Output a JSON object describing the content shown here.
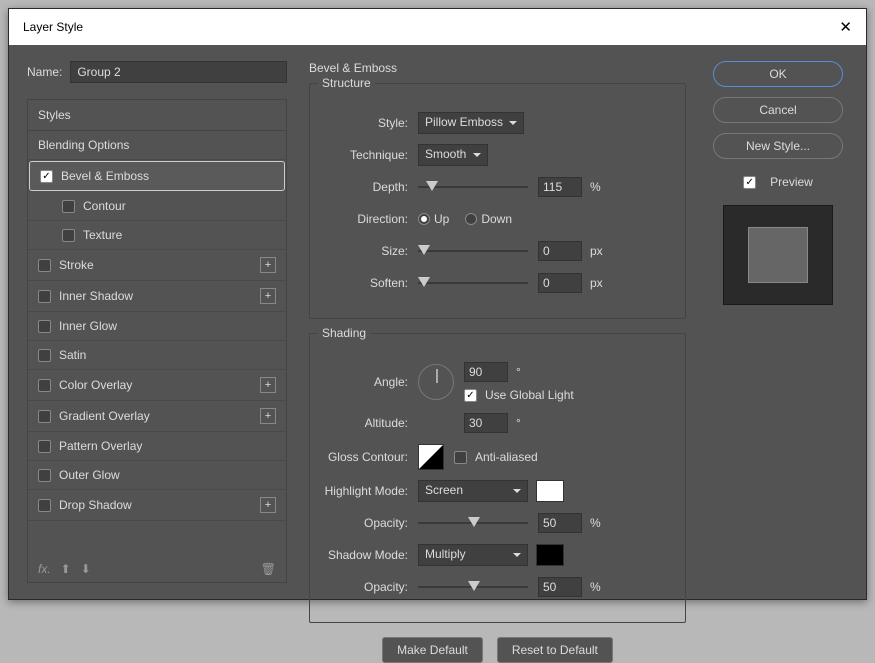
{
  "dialog": {
    "title": "Layer Style"
  },
  "name": {
    "label": "Name:",
    "value": "Group 2"
  },
  "styles_header": "Styles",
  "blending_options": "Blending Options",
  "styles": {
    "bevel": "Bevel & Emboss",
    "contour": "Contour",
    "texture": "Texture",
    "stroke": "Stroke",
    "inner_shadow": "Inner Shadow",
    "inner_glow": "Inner Glow",
    "satin": "Satin",
    "color_overlay": "Color Overlay",
    "gradient_overlay": "Gradient Overlay",
    "pattern_overlay": "Pattern Overlay",
    "outer_glow": "Outer Glow",
    "drop_shadow": "Drop Shadow"
  },
  "bevel": {
    "title": "Bevel & Emboss",
    "structure": {
      "legend": "Structure",
      "style_label": "Style:",
      "style_value": "Pillow Emboss",
      "technique_label": "Technique:",
      "technique_value": "Smooth",
      "depth_label": "Depth:",
      "depth_value": "115",
      "depth_unit": "%",
      "direction_label": "Direction:",
      "up": "Up",
      "down": "Down",
      "size_label": "Size:",
      "size_value": "0",
      "size_unit": "px",
      "soften_label": "Soften:",
      "soften_value": "0",
      "soften_unit": "px"
    },
    "shading": {
      "legend": "Shading",
      "angle_label": "Angle:",
      "angle_value": "90",
      "angle_unit": "°",
      "global_light": "Use Global Light",
      "altitude_label": "Altitude:",
      "altitude_value": "30",
      "altitude_unit": "°",
      "gloss_label": "Gloss Contour:",
      "anti_aliased": "Anti-aliased",
      "highlight_label": "Highlight Mode:",
      "highlight_value": "Screen",
      "highlight_color": "#ffffff",
      "opacity_label": "Opacity:",
      "highlight_opacity": "50",
      "shadow_label": "Shadow Mode:",
      "shadow_value": "Multiply",
      "shadow_color": "#000000",
      "shadow_opacity": "50",
      "pct": "%"
    },
    "make_default": "Make Default",
    "reset_default": "Reset to Default"
  },
  "buttons": {
    "ok": "OK",
    "cancel": "Cancel",
    "new_style": "New Style...",
    "preview": "Preview"
  }
}
